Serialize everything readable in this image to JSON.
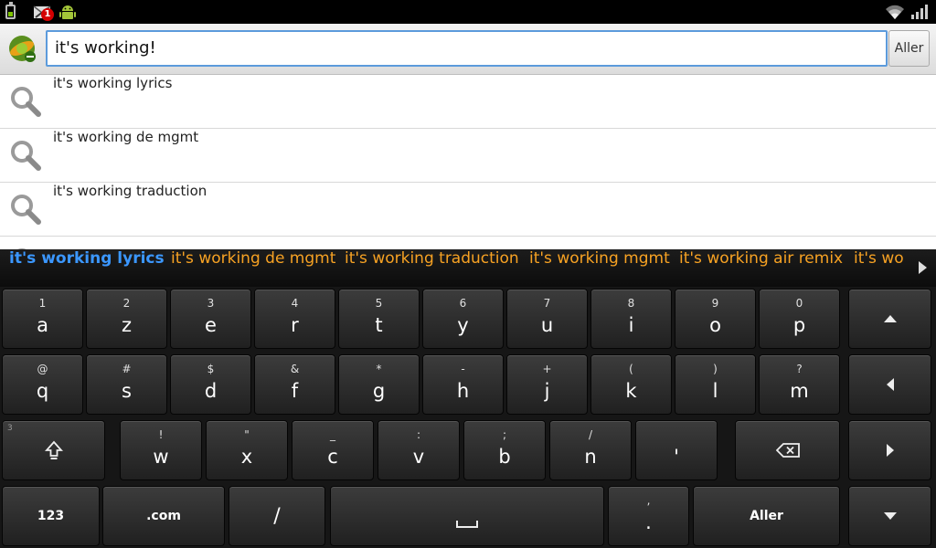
{
  "colors": {
    "input_focus": "#5c9bdc",
    "candidate_selected": "#3b97ff",
    "candidate": "#f7a223",
    "battery": "#7ec300"
  },
  "status_bar": {
    "notification_count": "1"
  },
  "search": {
    "query": "it's working!",
    "go_label": "Aller"
  },
  "suggestions": [
    {
      "text": "it's working lyrics"
    },
    {
      "text": "it's working de mgmt"
    },
    {
      "text": "it's working traduction"
    }
  ],
  "candidates": [
    {
      "text": "it's working lyrics"
    },
    {
      "text": "it's working de mgmt"
    },
    {
      "text": "it's working traduction"
    },
    {
      "text": "it's working mgmt"
    },
    {
      "text": "it's working air remix"
    },
    {
      "text": "it's wo"
    }
  ],
  "keyboard": {
    "row1": [
      {
        "hint": "1",
        "main": "a"
      },
      {
        "hint": "2",
        "main": "z"
      },
      {
        "hint": "3",
        "main": "e"
      },
      {
        "hint": "4",
        "main": "r"
      },
      {
        "hint": "5",
        "main": "t"
      },
      {
        "hint": "6",
        "main": "y"
      },
      {
        "hint": "7",
        "main": "u"
      },
      {
        "hint": "8",
        "main": "i"
      },
      {
        "hint": "9",
        "main": "o"
      },
      {
        "hint": "0",
        "main": "p"
      }
    ],
    "row2": [
      {
        "hint": "@",
        "main": "q"
      },
      {
        "hint": "#",
        "main": "s"
      },
      {
        "hint": "$",
        "main": "d"
      },
      {
        "hint": "&",
        "main": "f"
      },
      {
        "hint": "*",
        "main": "g"
      },
      {
        "hint": "-",
        "main": "h"
      },
      {
        "hint": "+",
        "main": "j"
      },
      {
        "hint": "(",
        "main": "k"
      },
      {
        "hint": ")",
        "main": "l"
      },
      {
        "hint": "?",
        "main": "m"
      }
    ],
    "row3": [
      {
        "hint": "!",
        "main": "w"
      },
      {
        "hint": "\"",
        "main": "x"
      },
      {
        "hint": "_",
        "main": "c"
      },
      {
        "hint": ":",
        "main": "v"
      },
      {
        "hint": ";",
        "main": "b"
      },
      {
        "hint": "/",
        "main": "n"
      },
      {
        "hint": "",
        "main": "'"
      }
    ],
    "shift_corner_hint": "3",
    "row4": {
      "symbols_label": "123",
      "dotcom_label": ".com",
      "slash_label": "/",
      "space_glyph": "␣",
      "period_hint": ",",
      "period_main": ".",
      "enter_label": "Aller"
    },
    "icons": {
      "shift": "shift-icon",
      "backspace": "backspace-icon",
      "up": "arrow-up-icon",
      "left": "arrow-left-icon",
      "right": "arrow-right-icon",
      "down": "arrow-down-icon"
    }
  }
}
